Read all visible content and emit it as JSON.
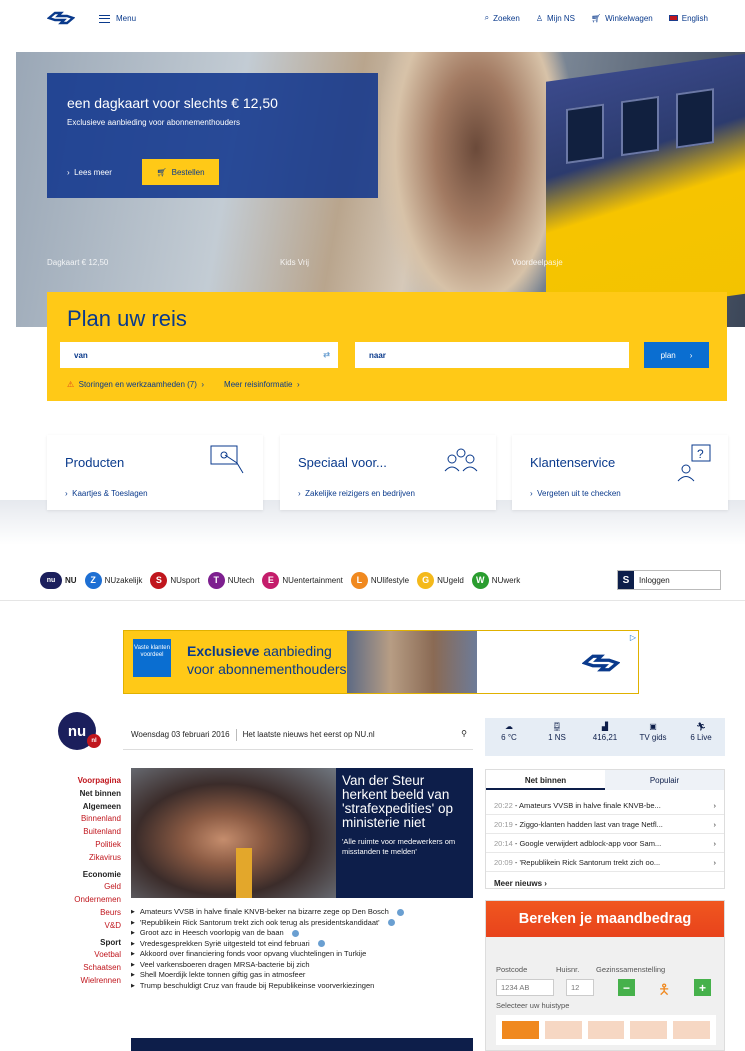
{
  "ns": {
    "menu_label": "Menu",
    "zoeken": "Zoeken",
    "mijn_ns": "Mijn NS",
    "winkelwagen": "Winkelwagen",
    "english": "English",
    "promo_title": "een dagkaart voor slechts € 12,50",
    "promo_sub": "Exclusieve aanbieding voor abonnementhouders",
    "lees_meer": "Lees meer",
    "bestellen": "Bestellen",
    "hero_labels": [
      "Dagkaart € 12,50",
      "Kids Vrij",
      "Voordeelpasje"
    ],
    "plan_title": "Plan uw reis",
    "van": "van",
    "naar": "naar",
    "plan_btn": "plan",
    "storingen": "Storingen en werkzaamheden (7)",
    "meer_info": "Meer reisinformatie",
    "cards": [
      {
        "title": "Producten",
        "sub": "Kaartjes & Toeslagen"
      },
      {
        "title": "Speciaal voor...",
        "sub": "Zakelijke reizigers en bedrijven"
      },
      {
        "title": "Klantenservice",
        "sub": "Vergeten uit te checken"
      }
    ],
    "colors": {
      "brand_blue": "#0a3a8c",
      "yellow": "#ffc917",
      "button_blue": "#0a6ed1"
    }
  },
  "nu": {
    "nav": [
      {
        "label": "NU",
        "icon": "nu-icon",
        "color": "#1b1f5c"
      },
      {
        "label": "NUzakelijk",
        "icon": "z-icon",
        "color": "#1e6fd3"
      },
      {
        "label": "NUsport",
        "icon": "s-icon",
        "color": "#c0161d"
      },
      {
        "label": "NUtech",
        "icon": "t-icon",
        "color": "#7d1f8f"
      },
      {
        "label": "NUentertainment",
        "icon": "e-icon",
        "color": "#c41d6b"
      },
      {
        "label": "NUlifestyle",
        "icon": "l-icon",
        "color": "#f0891f"
      },
      {
        "label": "NUgeld",
        "icon": "g-icon",
        "color": "#f4b91b"
      },
      {
        "label": "NUwerk",
        "icon": "w-icon",
        "color": "#2a9d2f"
      }
    ],
    "inloggen": "Inloggen",
    "ad": {
      "vaste": "Vaste klanten voordeel",
      "line1_bold": "Exclusieve",
      "line1_rest": " aanbieding",
      "line2": "voor abonnementhouders"
    },
    "logo_nl": "nl",
    "date": "Woensdag 03 februari 2016",
    "tagline": "Het laatste nieuws het eerst op NU.nl",
    "widgets": [
      {
        "icon": "weather-icon",
        "value": "6 °C"
      },
      {
        "icon": "train-icon",
        "value": "1 NS"
      },
      {
        "icon": "stock-icon",
        "value": "416,21"
      },
      {
        "icon": "tv-icon",
        "value": "TV gids"
      },
      {
        "icon": "sport-icon",
        "value": "6 Live"
      }
    ],
    "leftnav": [
      "Voorpagina",
      "Net binnen",
      "Algemeen",
      "Binnenland",
      "Buitenland",
      "Politiek",
      "Zikavirus",
      "Economie",
      "Geld",
      "Ondernemen",
      "Beurs",
      "V&D",
      "Sport",
      "Voetbal",
      "Schaatsen",
      "Wielrennen"
    ],
    "headline": {
      "title": "Van der Steur herkent beeld van 'strafexpedities' op ministerie niet",
      "sub": "'Alle ruimte voor medewerkers om misstanden te melden'"
    },
    "news": [
      "Amateurs VVSB in halve finale KNVB-beker na bizarre zege op Den Bosch",
      "'Republikein Rick Santorum trekt zich ook terug als presidentskandidaat'",
      "Groot azc in Heesch voorlopig van de baan",
      "Vredesgesprekken Syrië uitgesteld tot eind februari",
      "Akkoord over financiering fonds voor opvang vluchtelingen in Turkije",
      "Veel varkensboeren dragen MRSA-bacterie bij zich",
      "Shell Moerdijk lekte tonnen giftig gas in atmosfeer",
      "Trump beschuldigt Cruz van fraude bij Republikeinse voorverkiezingen"
    ],
    "tabs": {
      "active": "Net binnen",
      "other": "Populair"
    },
    "latest": [
      {
        "time": "20:22",
        "text": "Amateurs VVSB in halve finale KNVB-be..."
      },
      {
        "time": "20:19",
        "text": "Ziggo-klanten hadden last van trage Netfl..."
      },
      {
        "time": "20:14",
        "text": "Google verwijdert adblock-app voor Sam..."
      },
      {
        "time": "20:09",
        "text": "'Republikein Rick Santorum trekt zich oo..."
      }
    ],
    "meer_nieuws": "Meer nieuws",
    "bereken": {
      "title": "Bereken je maandbedrag",
      "postcode_lbl": "Postcode",
      "huisnr_lbl": "Huisnr.",
      "gezin_lbl": "Gezinssamenstelling",
      "postcode_ph": "1234 AB",
      "huisnr_ph": "12",
      "huistype_lbl": "Selecteer uw huistype"
    }
  }
}
